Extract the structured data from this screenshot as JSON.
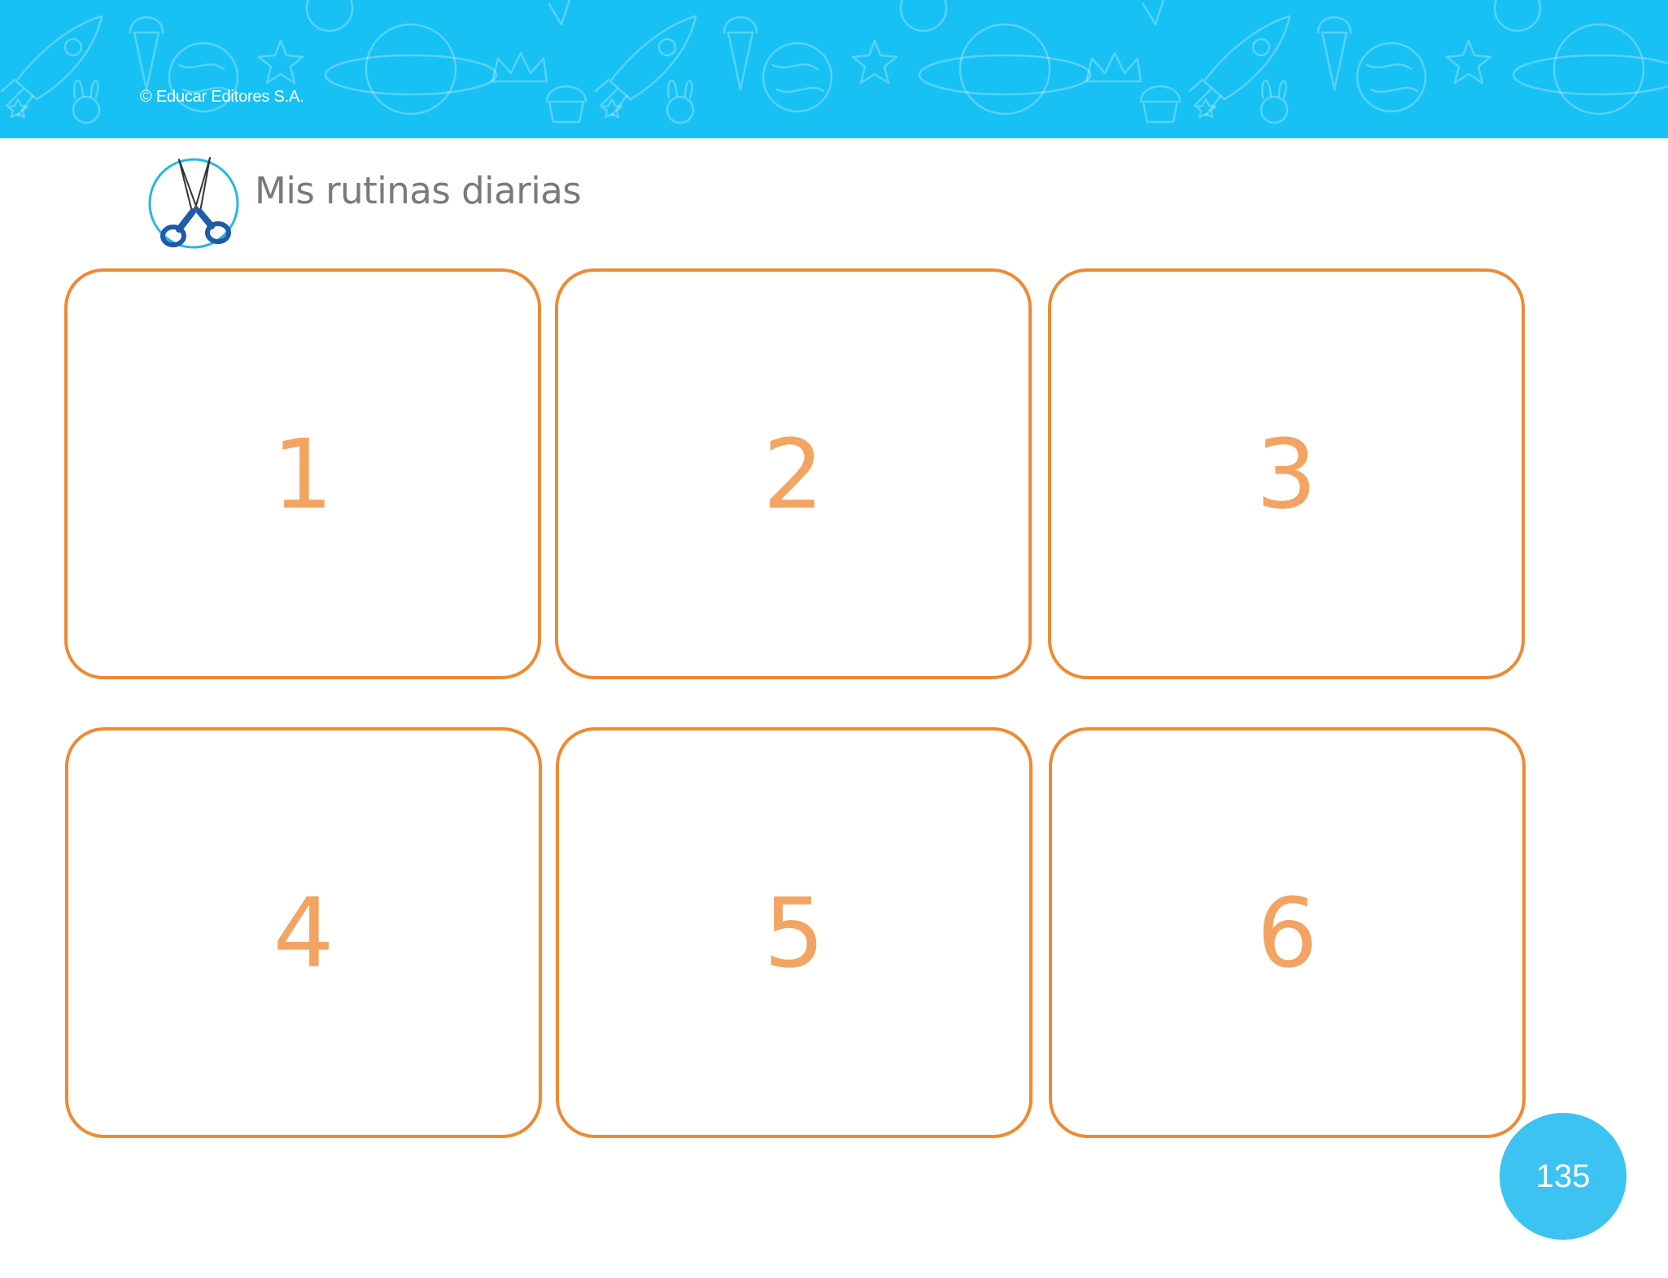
{
  "header": {
    "copyright": "© Educar Editores S.A.",
    "background_color": "#17c1f3",
    "pattern_icons": [
      "rocket-icon",
      "ice-cream-icon",
      "planet-icon",
      "star-icon",
      "bunny-icon",
      "crown-icon",
      "cupcake-icon",
      "globe-icon"
    ]
  },
  "title": {
    "icon": "scissors-icon",
    "text": "Mis rutinas diarias"
  },
  "cards": [
    {
      "number": "1"
    },
    {
      "number": "2"
    },
    {
      "number": "3"
    },
    {
      "number": "4"
    },
    {
      "number": "5"
    },
    {
      "number": "6"
    }
  ],
  "card_style": {
    "border_color": "#ee8a33",
    "number_color": "#f3a463"
  },
  "footer": {
    "page_number": "135",
    "badge_color": "#3cc3f1"
  }
}
